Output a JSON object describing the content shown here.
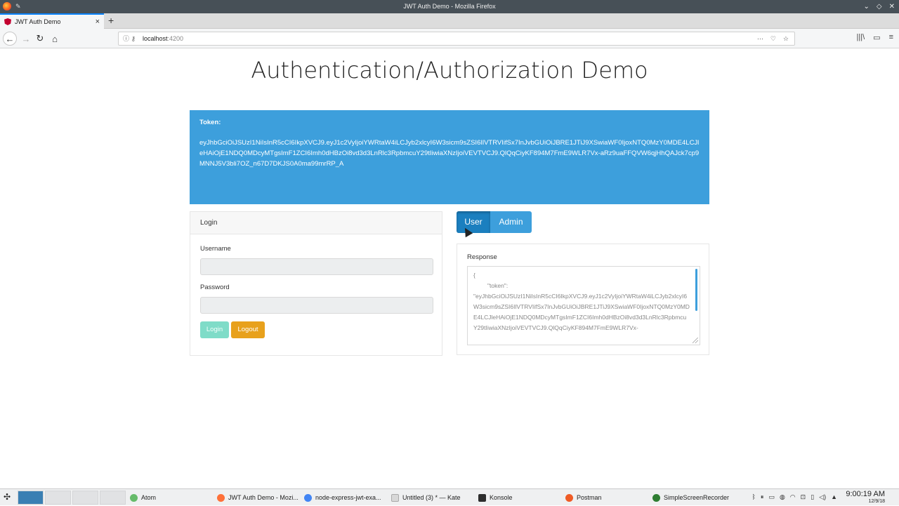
{
  "window": {
    "title": "JWT Auth Demo - Mozilla Firefox",
    "controls": [
      "⌄",
      "◇",
      "✕"
    ]
  },
  "tab": {
    "label": "JWT Auth Demo",
    "close": "×",
    "new_tab": "+"
  },
  "nav": {
    "back": "←",
    "forward": "→",
    "reload": "↻",
    "home": "⌂",
    "url_host": "localhost",
    "url_port": ":4200",
    "url_actions": [
      "···",
      "♡",
      "☆"
    ],
    "right_icons": [
      "|||\\",
      "▭",
      "≡"
    ]
  },
  "page": {
    "title": "Authentication/Authorization Demo",
    "token_label": "Token:",
    "token_value": "eyJhbGciOiJSUzI1NiIsInR5cCI6IkpXVCJ9.eyJ1c2VyIjoiYWRtaW4iLCJyb2xlcyI6W3sicm9sZSI6IlVTRVIifSx7InJvbGUiOiJBRE1JTiJ9XSwiaWF0IjoxNTQ0MzY0MDE4LCJleHAiOjE1NDQ0MDcyMTgsImF1ZCI6Imh0dHBzOi8vd3d3LnRlc3RpbmcuY29tIiwiaXNzIjoiVEVTVCJ9.QlQqCiyKF894M7FmE9WLR7Vx-aRz9uaFFQVW6qjHhQAJck7cp9MNNJ5V3bli7OZ_n67D7DKJS0A0ma99mrRP_A",
    "login": {
      "header": "Login",
      "username_label": "Username",
      "password_label": "Password",
      "login_button": "Login",
      "logout_button": "Logout"
    },
    "role_buttons": {
      "user": "User",
      "admin": "Admin"
    },
    "response": {
      "label": "Response",
      "open": "{",
      "key": "\"token\":",
      "value": "\"eyJhbGciOiJSUzI1NiIsInR5cCI6IkpXVCJ9.eyJ1c2VyIjoiYWRtaW4iLCJyb2xlcyI6W3sicm9sZSI6IlVTRVIifSx7InJvbGUiOiJBRE1JTiJ9XSwiaWF0IjoxNTQ0MzY0MDE4LCJleHAiOjE1NDQ0MDcyMTgsImF1ZCI6Imh0dHBzOi8vd3d3LnRlc3RpbmcuY29tIiwiaXNzIjoiVEVTVCJ9.QlQqCiyKF894M7FmE9WLR7Vx-"
    }
  },
  "taskbar": {
    "items": [
      {
        "label": "Atom",
        "color": "#66bb6a"
      },
      {
        "label": "JWT Auth Demo - Mozi...",
        "color": "#ff7139"
      },
      {
        "label": "node-express-jwt-exa...",
        "color": "#4285f4"
      },
      {
        "label": "Untitled (3) * — Kate",
        "color": "#d8d8d8"
      },
      {
        "label": "Konsole",
        "color": "#2d2d2d"
      },
      {
        "label": "Postman",
        "color": "#ef5b25"
      },
      {
        "label": "SimpleScreenRecorder",
        "color": "#2e7d32"
      }
    ],
    "time": "9:00:19 AM",
    "date": "12/9/18"
  },
  "colors": {
    "primary": "#3d9fdc",
    "primary_active": "#1b7fbf",
    "success_light": "#7fdcc8",
    "warning": "#e8a11c"
  }
}
